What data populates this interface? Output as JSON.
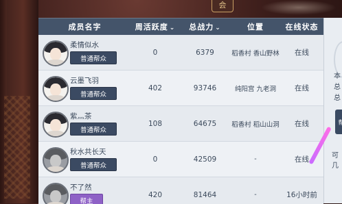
{
  "top_badge": "会",
  "header": {
    "name": "成员名字",
    "activity": "周活跃度",
    "power": "总战力",
    "location": "位置",
    "status": "在线状态",
    "chevron": "⌄"
  },
  "rows": [
    {
      "name": "柔情似水",
      "role": "普通帮众",
      "activity": "0",
      "power": "6379",
      "location": "稻香村 香山野林",
      "status": "在线"
    },
    {
      "name": "云墨飞羽",
      "role": "普通帮众",
      "activity": "402",
      "power": "93746",
      "location": "纯阳宫 九老洞",
      "status": "在线"
    },
    {
      "name": "紫灬茶",
      "role": "普通帮众",
      "activity": "108",
      "power": "64675",
      "location": "稻香村 稻山山洞",
      "status": "在线"
    },
    {
      "name": "秋水共长天",
      "role": "普通帮众",
      "activity": "0",
      "power": "42509",
      "location": "-",
      "status": "在线"
    },
    {
      "name": "不了然",
      "role": "帮主",
      "activity": "420",
      "power": "81464",
      "location": "-",
      "status": "16小时前"
    }
  ],
  "side": {
    "t1": "本",
    "t2": "总",
    "t3": "总",
    "t4": "可几",
    "btn": "帮"
  },
  "colors": {
    "header_bg": "#44546a",
    "role_normal": "#3b4a62",
    "role_leader": "#8e61c6"
  }
}
